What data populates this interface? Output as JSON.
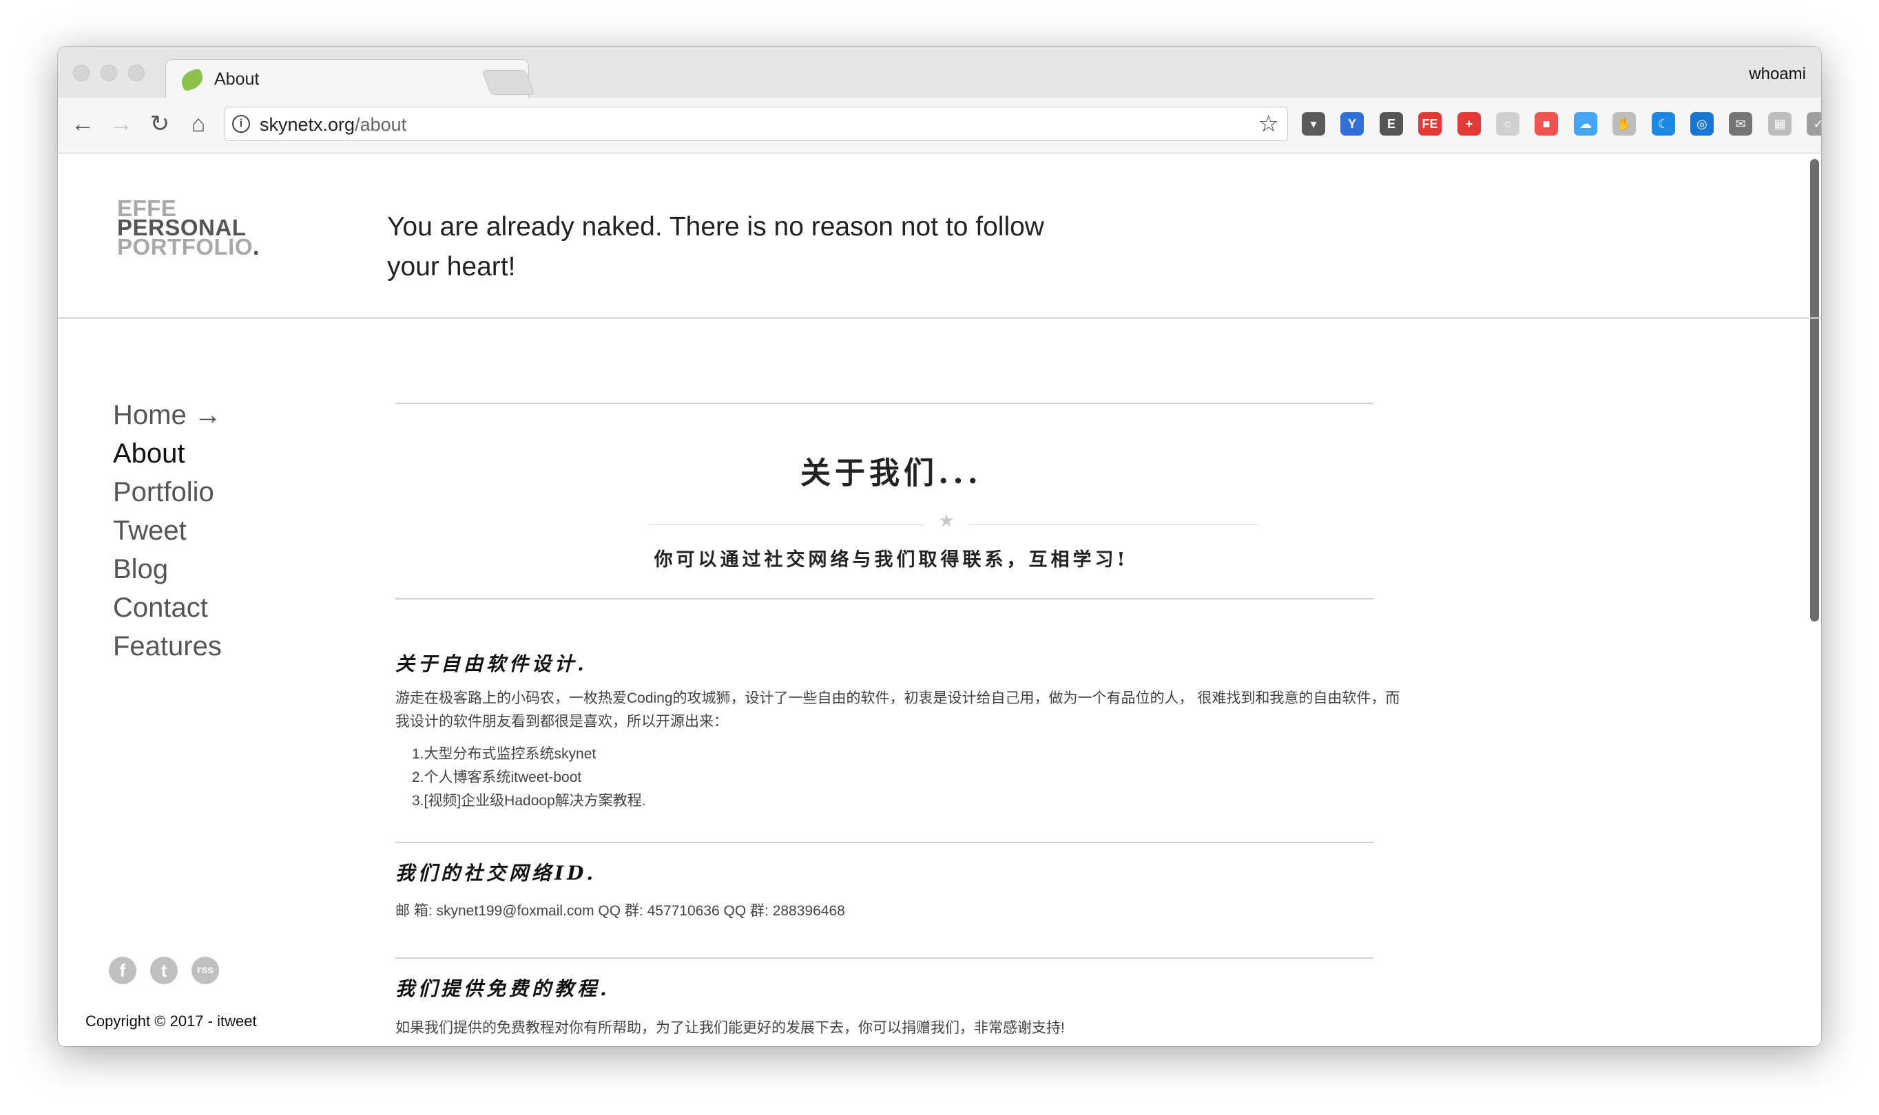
{
  "browser": {
    "tab_title": "About",
    "tab_close": "×",
    "profile_name": "whoami",
    "url_host": "skynetx.org",
    "url_path": "/about",
    "back_icon": "←",
    "forward_icon": "→",
    "reload_icon": "↻",
    "home_icon": "⌂",
    "star_icon": "☆",
    "info_icon": "i"
  },
  "extensions": [
    {
      "name": "pocket-icon",
      "color": "#5b5b5b",
      "glyph": "▾"
    },
    {
      "name": "y-extension-icon",
      "color": "#2f6fd6",
      "glyph": "Y"
    },
    {
      "name": "evernote-icon",
      "color": "#555555",
      "glyph": "E"
    },
    {
      "name": "fe-extension-icon",
      "color": "#e53935",
      "glyph": "FE"
    },
    {
      "name": "plus-extension-icon",
      "color": "#e53935",
      "glyph": "+"
    },
    {
      "name": "gray-circle-icon",
      "color": "#d0d0d0",
      "glyph": "○"
    },
    {
      "name": "red-extension-icon",
      "color": "#ef5350",
      "glyph": "■"
    },
    {
      "name": "cloud-icon",
      "color": "#42a5f5",
      "glyph": "☁"
    },
    {
      "name": "hand-icon",
      "color": "#bdbdbd",
      "glyph": "✋"
    },
    {
      "name": "moon-icon",
      "color": "#1e88e5",
      "glyph": "☾"
    },
    {
      "name": "compass-icon",
      "color": "#1976d2",
      "glyph": "◎"
    },
    {
      "name": "mail-icon",
      "color": "#757575",
      "glyph": "✉"
    },
    {
      "name": "grid-extension-icon",
      "color": "#bdbdbd",
      "glyph": "▦"
    },
    {
      "name": "check-icon",
      "color": "#9e9e9e",
      "glyph": "✓"
    },
    {
      "name": "upload-icon",
      "color": "#ffa726",
      "glyph": "↑"
    }
  ],
  "site": {
    "logo_line1": "EFFE",
    "logo_line2": "PERSONAL",
    "logo_line3": "PORTFOLIO",
    "logo_dot": ".",
    "tagline": "You are already naked. There is no reason not to follow your heart!",
    "nav": [
      "Home →",
      "About",
      "Portfolio",
      "Tweet",
      "Blog",
      "Contact",
      "Features"
    ],
    "nav_active_index": 1,
    "social_icons": [
      "f",
      "t",
      "rss"
    ],
    "copyright": "Copyright © 2017 - itweet"
  },
  "content": {
    "title": "关于我们...",
    "subtitle": "你可以通过社交网络与我们取得联系，互相学习!",
    "section1_title": "关于自由软件设计.",
    "section1_text": "游走在极客路上的小码农，一枚热爱Coding的攻城狮，设计了一些自由的软件，初衷是设计给自己用，做为一个有品位的人， 很难找到和我意的自由软件，而我设计的软件朋友看到都很是喜欢，所以开源出来：",
    "section1_list": [
      "1.大型分布式监控系统skynet",
      "2.个人博客系统itweet-boot",
      "3.[视频]企业级Hadoop解决方案教程."
    ],
    "section2_title": "我们的社交网络ID.",
    "section2_text": "邮 箱: skynet199@foxmail.com QQ 群: 457710636 QQ 群: 288396468",
    "section3_title": "我们提供免费的教程.",
    "section3_text": "如果我们提供的免费教程对你有所帮助，为了让我们能更好的发展下去，你可以捐赠我们，非常感谢支持!"
  }
}
